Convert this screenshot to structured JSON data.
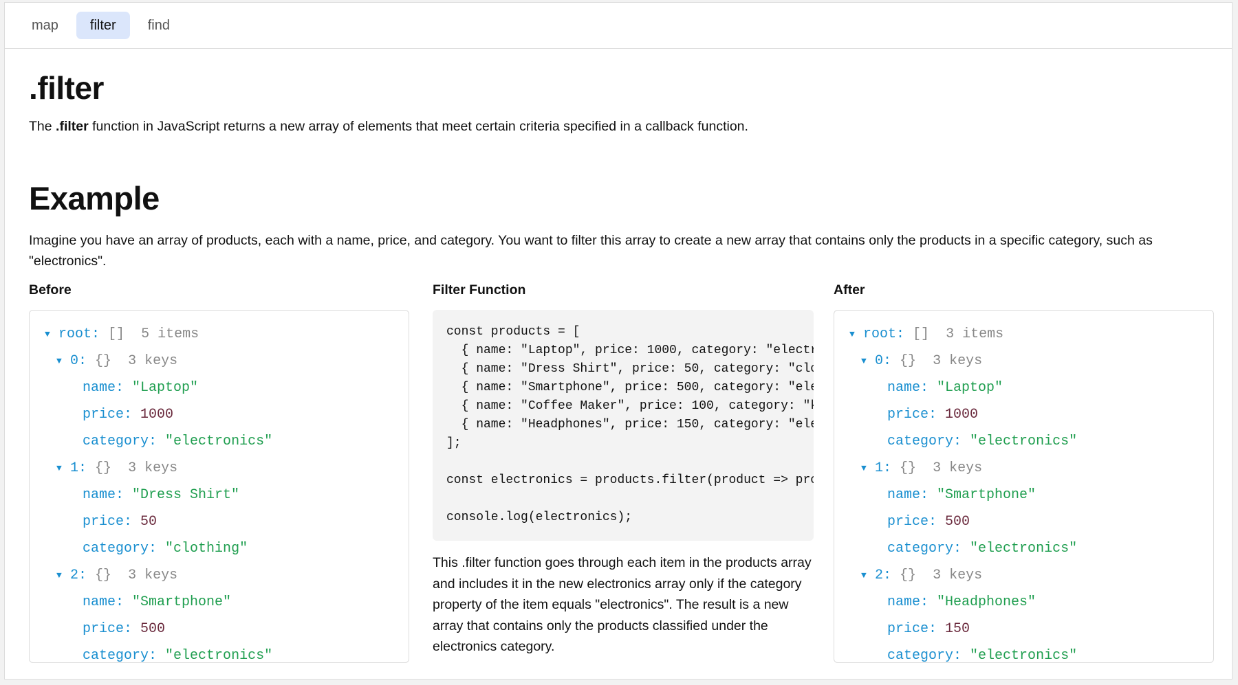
{
  "tabs": [
    {
      "label": "map",
      "active": false
    },
    {
      "label": "filter",
      "active": true
    },
    {
      "label": "find",
      "active": false
    }
  ],
  "header": {
    "title": ".filter",
    "intro_pre": "The ",
    "intro_bold": ".filter",
    "intro_post": " function in JavaScript returns a new array of elements that meet certain criteria specified in a callback function."
  },
  "example": {
    "heading": "Example",
    "description": "Imagine you have an array of products, each with a name, price, and category. You want to filter this array to create a new array that contains only the products in a specific category, such as \"electronics\"."
  },
  "before": {
    "title": "Before",
    "root_label": "root:",
    "root_type": "[]",
    "root_count": "5 items",
    "items": [
      {
        "index": "0:",
        "type": "{}",
        "count": "3 keys",
        "name": "\"Laptop\"",
        "price": "1000",
        "category": "\"electronics\""
      },
      {
        "index": "1:",
        "type": "{}",
        "count": "3 keys",
        "name": "\"Dress Shirt\"",
        "price": "50",
        "category": "\"clothing\""
      },
      {
        "index": "2:",
        "type": "{}",
        "count": "3 keys",
        "name": "\"Smartphone\"",
        "price": "500",
        "category": "\"electronics\""
      }
    ]
  },
  "filter_function": {
    "title": "Filter Function",
    "code": "const products = [\n  { name: \"Laptop\", price: 1000, category: \"electronics\" },\n  { name: \"Dress Shirt\", price: 50, category: \"clothing\" },\n  { name: \"Smartphone\", price: 500, category: \"electronics\" },\n  { name: \"Coffee Maker\", price: 100, category: \"kitchen\" },\n  { name: \"Headphones\", price: 150, category: \"electronics\" }\n];\n\nconst electronics = products.filter(product => product.category === \"electronics\");\n\nconsole.log(electronics);",
    "explanation": "This .filter function goes through each item in the products array and includes it in the new electronics array only if the category property of the item equals \"electronics\". The result is a new array that contains only the products classified under the electronics category."
  },
  "after": {
    "title": "After",
    "root_label": "root:",
    "root_type": "[]",
    "root_count": "3 items",
    "items": [
      {
        "index": "0:",
        "type": "{}",
        "count": "3 keys",
        "name": "\"Laptop\"",
        "price": "1000",
        "category": "\"electronics\""
      },
      {
        "index": "1:",
        "type": "{}",
        "count": "3 keys",
        "name": "\"Smartphone\"",
        "price": "500",
        "category": "\"electronics\""
      },
      {
        "index": "2:",
        "type": "{}",
        "count": "3 keys",
        "name": "\"Headphones\"",
        "price": "150",
        "category": "\"electronics\""
      }
    ]
  },
  "labels": {
    "name": "name:",
    "price": "price:",
    "category": "category:"
  },
  "icons": {
    "expand": "caret-down-icon"
  }
}
